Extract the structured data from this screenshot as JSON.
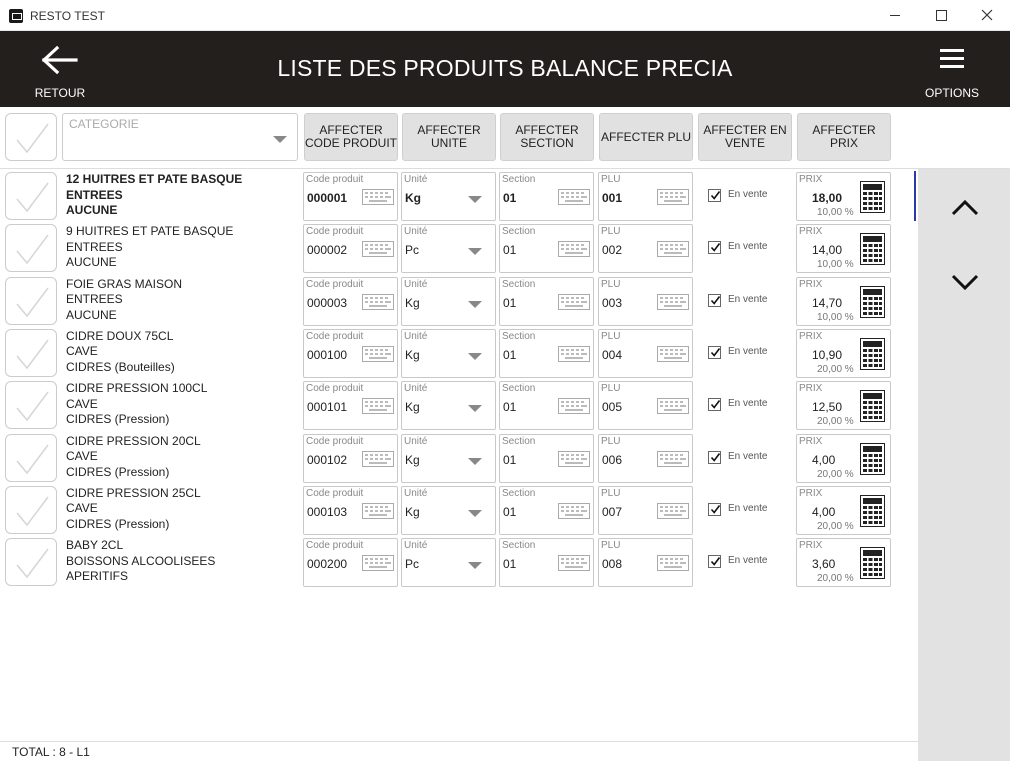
{
  "window": {
    "title": "RESTO TEST"
  },
  "header": {
    "back_label": "RETOUR",
    "title": "LISTE DES PRODUITS BALANCE PRECIA",
    "options_label": "OPTIONS"
  },
  "toolbar": {
    "category_placeholder": "CATEGORIE",
    "buttons": [
      {
        "label": "AFFECTER\nCODE PRODUIT"
      },
      {
        "label": "AFFECTER\nUNITE"
      },
      {
        "label": "AFFECTER\nSECTION"
      },
      {
        "label": "AFFECTER PLU"
      },
      {
        "label": "AFFECTER EN\nVENTE"
      },
      {
        "label": "AFFECTER\nPRIX"
      }
    ]
  },
  "labels": {
    "code": "Code produit",
    "unit": "Unité",
    "section": "Section",
    "plu": "PLU",
    "sale": "En vente",
    "price": "PRIX"
  },
  "rows": [
    {
      "name": "12 HUITRES ET PATE BASQUE",
      "family": "ENTREES",
      "sub": "AUCUNE",
      "code": "000001",
      "unit": "Kg",
      "section": "01",
      "plu": "001",
      "on_sale": true,
      "price": "18,00",
      "tax": "10,00 %",
      "selected": true
    },
    {
      "name": "9 HUITRES ET PATE BASQUE",
      "family": "ENTREES",
      "sub": "AUCUNE",
      "code": "000002",
      "unit": "Pc",
      "section": "01",
      "plu": "002",
      "on_sale": true,
      "price": "14,00",
      "tax": "10,00 %",
      "selected": false
    },
    {
      "name": "FOIE GRAS MAISON",
      "family": "ENTREES",
      "sub": "AUCUNE",
      "code": "000003",
      "unit": "Kg",
      "section": "01",
      "plu": "003",
      "on_sale": true,
      "price": "14,70",
      "tax": "10,00 %",
      "selected": false
    },
    {
      "name": "CIDRE DOUX 75CL",
      "family": "CAVE",
      "sub": "CIDRES (Bouteilles)",
      "code": "000100",
      "unit": "Kg",
      "section": "01",
      "plu": "004",
      "on_sale": true,
      "price": "10,90",
      "tax": "20,00 %",
      "selected": false
    },
    {
      "name": "CIDRE PRESSION 100CL",
      "family": "CAVE",
      "sub": "CIDRES (Pression)",
      "code": "000101",
      "unit": "Kg",
      "section": "01",
      "plu": "005",
      "on_sale": true,
      "price": "12,50",
      "tax": "20,00 %",
      "selected": false
    },
    {
      "name": "CIDRE PRESSION 20CL",
      "family": "CAVE",
      "sub": "CIDRES (Pression)",
      "code": "000102",
      "unit": "Kg",
      "section": "01",
      "plu": "006",
      "on_sale": true,
      "price": "4,00",
      "tax": "20,00 %",
      "selected": false
    },
    {
      "name": "CIDRE PRESSION 25CL",
      "family": "CAVE",
      "sub": "CIDRES (Pression)",
      "code": "000103",
      "unit": "Kg",
      "section": "01",
      "plu": "007",
      "on_sale": true,
      "price": "4,00",
      "tax": "20,00 %",
      "selected": false
    },
    {
      "name": "BABY 2CL",
      "family": "BOISSONS ALCOOLISEES",
      "sub": "APERITIFS",
      "code": "000200",
      "unit": "Pc",
      "section": "01",
      "plu": "008",
      "on_sale": true,
      "price": "3,60",
      "tax": "20,00 %",
      "selected": false
    }
  ],
  "footer": {
    "total": "TOTAL : 8  - L1"
  },
  "icons": {
    "back": "arrow-left-icon",
    "menu": "hamburger-icon",
    "up": "chevron-up-icon",
    "down": "chevron-down-icon",
    "keyboard": "keyboard-icon",
    "calculator": "calculator-icon"
  },
  "colors": {
    "header_bg": "#231f1c",
    "sidebar_bg": "#e2e2e2",
    "button_bg": "#e1e1e1",
    "scroll_indicator": "#2b3aa8"
  }
}
